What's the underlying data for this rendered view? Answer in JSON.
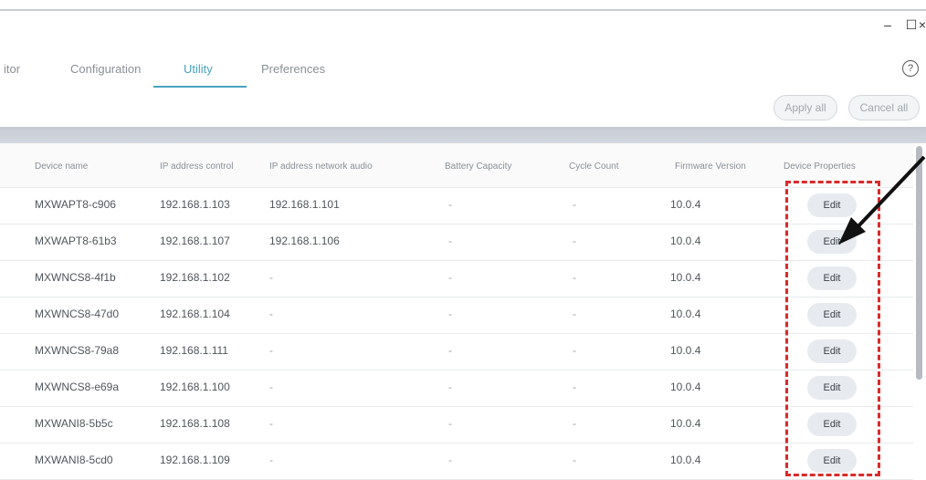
{
  "window": {
    "minimize": "–",
    "maximize": "☐",
    "close": "×"
  },
  "tabs": [
    {
      "label": "itor"
    },
    {
      "label": "Configuration"
    },
    {
      "label": "Utility"
    },
    {
      "label": "Preferences"
    }
  ],
  "help_label": "?",
  "actions": {
    "apply_all": "Apply all",
    "cancel_all": "Cancel all"
  },
  "table": {
    "headers": [
      "Device name",
      "IP address control",
      "IP address network audio",
      "Battery Capacity",
      "Cycle Count",
      "Firmware Version",
      "Device Properties"
    ],
    "rows": [
      {
        "name": "MXWAPT8-c906",
        "ip_control": "192.168.1.103",
        "ip_audio": "192.168.1.101",
        "battery": "-",
        "cycle": "-",
        "firmware": "10.0.4",
        "action": "Edit"
      },
      {
        "name": "MXWAPT8-61b3",
        "ip_control": "192.168.1.107",
        "ip_audio": "192.168.1.106",
        "battery": "-",
        "cycle": "-",
        "firmware": "10.0.4",
        "action": "Edit"
      },
      {
        "name": "MXWNCS8-4f1b",
        "ip_control": "192.168.1.102",
        "ip_audio": "-",
        "battery": "-",
        "cycle": "-",
        "firmware": "10.0.4",
        "action": "Edit"
      },
      {
        "name": "MXWNCS8-47d0",
        "ip_control": "192.168.1.104",
        "ip_audio": "-",
        "battery": "-",
        "cycle": "-",
        "firmware": "10.0.4",
        "action": "Edit"
      },
      {
        "name": "MXWNCS8-79a8",
        "ip_control": "192.168.1.111",
        "ip_audio": "-",
        "battery": "-",
        "cycle": "-",
        "firmware": "10.0.4",
        "action": "Edit"
      },
      {
        "name": "MXWNCS8-e69a",
        "ip_control": "192.168.1.100",
        "ip_audio": "-",
        "battery": "-",
        "cycle": "-",
        "firmware": "10.0.4",
        "action": "Edit"
      },
      {
        "name": "MXWANI8-5b5c",
        "ip_control": "192.168.1.108",
        "ip_audio": "-",
        "battery": "-",
        "cycle": "-",
        "firmware": "10.0.4",
        "action": "Edit"
      },
      {
        "name": "MXWANI8-5cd0",
        "ip_control": "192.168.1.109",
        "ip_audio": "-",
        "battery": "-",
        "cycle": "-",
        "firmware": "10.0.4",
        "action": "Edit"
      }
    ]
  },
  "annotation": {
    "highlight_color": "#d92b2b",
    "arrow_color": "#111111"
  }
}
